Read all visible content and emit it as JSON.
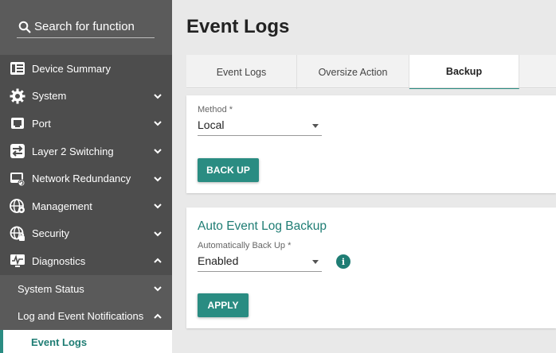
{
  "sidebar": {
    "search_placeholder": "Search for function",
    "items": [
      {
        "label": "Device Summary",
        "icon": "device-summary-icon"
      },
      {
        "label": "System",
        "icon": "gear-icon"
      },
      {
        "label": "Port",
        "icon": "port-icon"
      },
      {
        "label": "Layer 2 Switching",
        "icon": "switching-icon"
      },
      {
        "label": "Network Redundancy",
        "icon": "redundancy-icon"
      },
      {
        "label": "Management",
        "icon": "management-icon"
      },
      {
        "label": "Security",
        "icon": "security-globe-icon"
      },
      {
        "label": "Diagnostics",
        "icon": "diagnostics-icon"
      }
    ],
    "diagnostics_sub": [
      {
        "label": "System Status"
      },
      {
        "label": "Log and Event Notifications"
      }
    ],
    "log_sub": [
      {
        "label": "Event Logs"
      }
    ]
  },
  "main": {
    "title": "Event Logs",
    "tabs": [
      {
        "label": "Event Logs"
      },
      {
        "label": "Oversize Action"
      },
      {
        "label": "Backup"
      }
    ],
    "active_tab": "Backup",
    "method": {
      "label": "Method *",
      "value": "Local"
    },
    "backup_button": "BACK UP",
    "auto": {
      "title": "Auto Event Log Backup",
      "label": "Automatically Back Up *",
      "value": "Enabled",
      "info_glyph": "i",
      "apply_button": "APPLY"
    }
  },
  "colors": {
    "accent": "#2a8c82",
    "sidebar_bg": "#4d4d4d",
    "page_bg": "#e9e9e9"
  }
}
